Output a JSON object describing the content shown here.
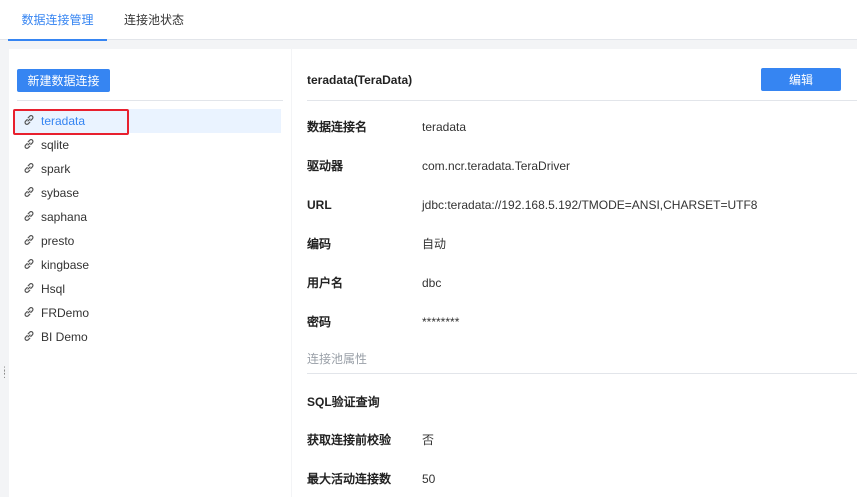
{
  "tabs": [
    {
      "label": "数据连接管理",
      "active": true
    },
    {
      "label": "连接池状态",
      "active": false
    }
  ],
  "left_panel": {
    "new_button": "新建数据连接",
    "connections": [
      {
        "label": "teradata",
        "active": true
      },
      {
        "label": "sqlite"
      },
      {
        "label": "spark"
      },
      {
        "label": "sybase"
      },
      {
        "label": "saphana"
      },
      {
        "label": "presto"
      },
      {
        "label": "kingbase"
      },
      {
        "label": "Hsql"
      },
      {
        "label": "FRDemo"
      },
      {
        "label": "BI Demo"
      }
    ],
    "icon": "link-icon"
  },
  "detail": {
    "title": "teradata(TeraData)",
    "edit_button": "编辑",
    "fields": [
      {
        "label": "数据连接名",
        "value": "teradata"
      },
      {
        "label": "驱动器",
        "value": "com.ncr.teradata.TeraDriver"
      },
      {
        "label": "URL",
        "value": "jdbc:teradata://192.168.5.192/TMODE=ANSI,CHARSET=UTF8"
      },
      {
        "label": "编码",
        "value": "自动"
      },
      {
        "label": "用户名",
        "value": "dbc"
      },
      {
        "label": "密码",
        "value": "********"
      }
    ],
    "pool_section_title": "连接池属性",
    "pool_fields": [
      {
        "label": "SQL验证查询",
        "value": ""
      },
      {
        "label": "获取连接前校验",
        "value": "否"
      },
      {
        "label": "最大活动连接数",
        "value": "50"
      }
    ]
  },
  "colors": {
    "accent": "#3685f2",
    "highlight_border": "#e8202e",
    "active_row": "#eaf3ff"
  }
}
